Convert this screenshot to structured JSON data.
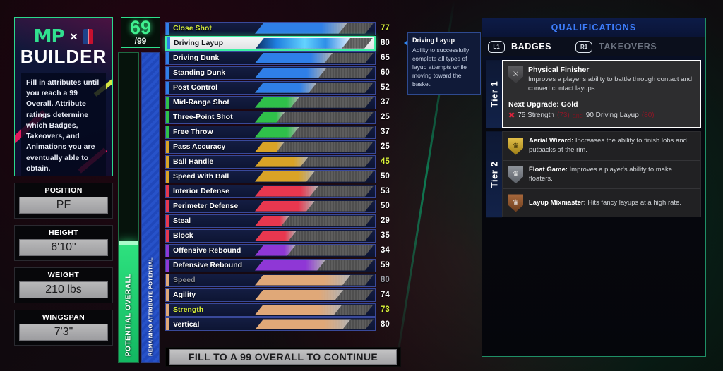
{
  "brand": {
    "mp_mark": "MP",
    "x": "✕",
    "nba_icon": "nba-logo-icon",
    "builder_word": "BUILDER",
    "description": "Fill in attributes until you reach a 99 Overall. Attribute ratings determine which Badges, Takeovers, and Animations you are eventually able to obtain."
  },
  "player_info": [
    {
      "label": "POSITION",
      "value": "PF"
    },
    {
      "label": "HEIGHT",
      "value": "6'10\""
    },
    {
      "label": "WEIGHT",
      "value": "210 lbs"
    },
    {
      "label": "WINGSPAN",
      "value": "7'3\""
    }
  ],
  "overall": {
    "current": "69",
    "max": "/99",
    "overall_label": "POTENTIAL OVERALL",
    "remaining_label": "REMAINING ATTRIBUTE POTENTIAL",
    "overall_fill_pct": 39,
    "remaining_fill_pct": 100
  },
  "attributes": {
    "max": 99,
    "rows": [
      {
        "name": "Close Shot",
        "value": 77,
        "color": "#2f7fe8",
        "accent": "#2f7fe8",
        "state": "yellow-label"
      },
      {
        "name": "Driving Layup",
        "value": 80,
        "color": "#2f7fe8",
        "accent": "#2f7fe8",
        "state": "selected"
      },
      {
        "name": "Driving Dunk",
        "value": 65,
        "color": "#2f7fe8",
        "accent": "#2f7fe8",
        "state": "normal"
      },
      {
        "name": "Standing Dunk",
        "value": 60,
        "color": "#2f7fe8",
        "accent": "#2f7fe8",
        "state": "normal"
      },
      {
        "name": "Post Control",
        "value": 52,
        "color": "#2f7fe8",
        "accent": "#2f7fe8",
        "state": "normal"
      },
      {
        "name": "Mid-Range Shot",
        "value": 37,
        "color": "#2fc04a",
        "accent": "#2fc04a",
        "state": "normal"
      },
      {
        "name": "Three-Point Shot",
        "value": 25,
        "color": "#2fc04a",
        "accent": "#2fc04a",
        "state": "normal"
      },
      {
        "name": "Free Throw",
        "value": 37,
        "color": "#2fc04a",
        "accent": "#2fc04a",
        "state": "normal"
      },
      {
        "name": "Pass Accuracy",
        "value": 25,
        "color": "#d9a326",
        "accent": "#d9a326",
        "state": "normal"
      },
      {
        "name": "Ball Handle",
        "value": 45,
        "color": "#d9a326",
        "accent": "#d9a326",
        "state": "yellow-value"
      },
      {
        "name": "Speed With Ball",
        "value": 50,
        "color": "#d9a326",
        "accent": "#d9a326",
        "state": "normal"
      },
      {
        "name": "Interior Defense",
        "value": 53,
        "color": "#e8374f",
        "accent": "#e8374f",
        "state": "normal"
      },
      {
        "name": "Perimeter Defense",
        "value": 50,
        "color": "#e8374f",
        "accent": "#e8374f",
        "state": "normal"
      },
      {
        "name": "Steal",
        "value": 29,
        "color": "#e8374f",
        "accent": "#e8374f",
        "state": "normal"
      },
      {
        "name": "Block",
        "value": 35,
        "color": "#e8374f",
        "accent": "#e8374f",
        "state": "normal"
      },
      {
        "name": "Offensive Rebound",
        "value": 34,
        "color": "#8f37d6",
        "accent": "#8f37d6",
        "state": "normal"
      },
      {
        "name": "Defensive Rebound",
        "value": 59,
        "color": "#8f37d6",
        "accent": "#8f37d6",
        "state": "normal"
      },
      {
        "name": "Speed",
        "value": 80,
        "color": "#e0a878",
        "accent": "#e0a878",
        "state": "dim"
      },
      {
        "name": "Agility",
        "value": 74,
        "color": "#e0a878",
        "accent": "#e0a878",
        "state": "normal"
      },
      {
        "name": "Strength",
        "value": 73,
        "color": "#e0a878",
        "accent": "#e0a878",
        "state": "yellow-value-label"
      },
      {
        "name": "Vertical",
        "value": 80,
        "color": "#e0a878",
        "accent": "#e0a878",
        "state": "normal"
      }
    ]
  },
  "continue_button": {
    "label": "FILL TO A 99 OVERALL TO CONTINUE"
  },
  "tooltip": {
    "title": "Driving Layup",
    "body": "Ability to successfully complete all types of layup attempts while moving toward the basket."
  },
  "qualifications": {
    "title": "QUALIFICATIONS",
    "left_bumper": "L1",
    "right_bumper": "R1",
    "tab_badges": "BADGES",
    "tab_takeovers": "TAKEOVERS",
    "tier1": {
      "label": "Tier 1",
      "badge_icon": "physical-finisher-badge-icon",
      "badge_name": "Physical Finisher",
      "badge_desc": "Improves a player's ability to battle through contact and convert contact layups.",
      "upgrade_title": "Next Upgrade: Gold",
      "req_x": "✖",
      "req1_target": "75 Strength",
      "req1_current": "(73)",
      "req_connector": "and",
      "req2_target": "90 Driving Layup",
      "req2_current": "(80)"
    },
    "tier2": {
      "label": "Tier 2",
      "badges": [
        {
          "icon": "aerial-wizard-badge-icon",
          "tier_color": "gold",
          "name": "Aerial Wizard:",
          "desc": " Increases the ability to finish lobs and putbacks at the rim."
        },
        {
          "icon": "float-game-badge-icon",
          "tier_color": "silver",
          "name": "Float Game:",
          "desc": " Improves a player's ability to make floaters."
        },
        {
          "icon": "layup-mixmaster-badge-icon",
          "tier_color": "bronze",
          "name": "Layup Mixmaster:",
          "desc": " Hits fancy layups at a high rate."
        }
      ]
    }
  }
}
